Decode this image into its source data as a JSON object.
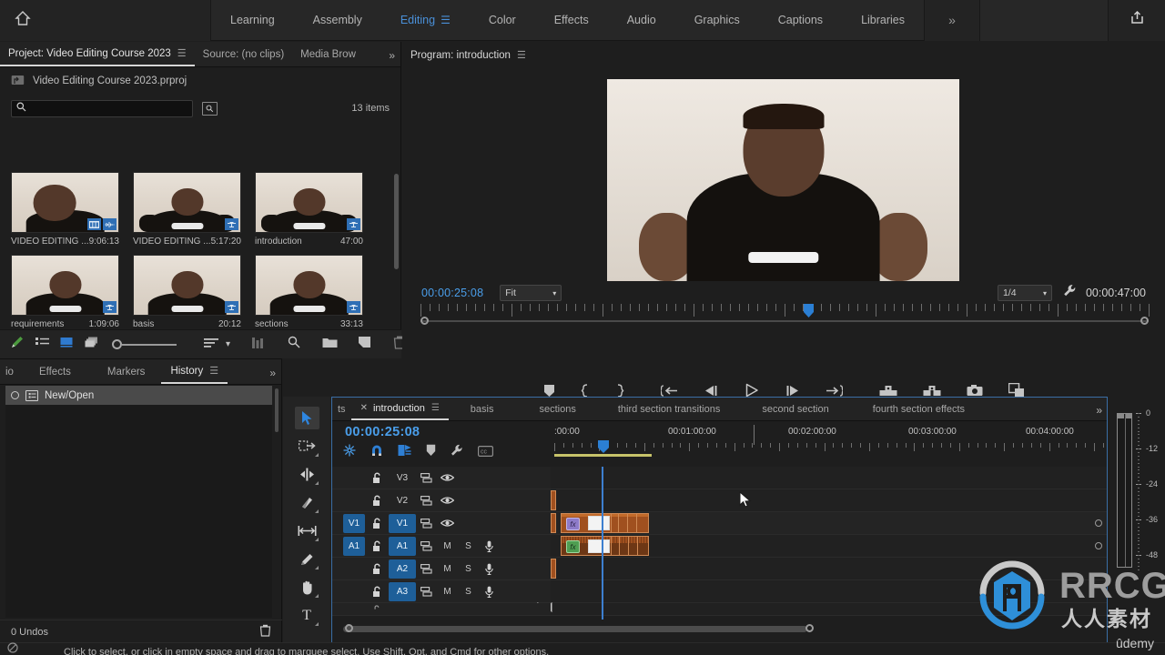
{
  "app": {
    "workspaces": [
      {
        "label": "Learning",
        "active": false
      },
      {
        "label": "Assembly",
        "active": false
      },
      {
        "label": "Editing",
        "active": true
      },
      {
        "label": "Color",
        "active": false
      },
      {
        "label": "Effects",
        "active": false
      },
      {
        "label": "Audio",
        "active": false
      },
      {
        "label": "Graphics",
        "active": false
      },
      {
        "label": "Captions",
        "active": false
      },
      {
        "label": "Libraries",
        "active": false
      }
    ],
    "overflow_label": "»",
    "home_icon": "home-icon",
    "export_icon": "export-icon"
  },
  "project_panel": {
    "tabs": [
      {
        "label": "Project: Video Editing Course 2023",
        "active": true,
        "has_menu": true
      },
      {
        "label": "Source: (no clips)",
        "active": false,
        "has_menu": false
      },
      {
        "label": "Media Brow",
        "active": false,
        "has_menu": false
      }
    ],
    "overflow_label": "»",
    "project_file": "Video Editing Course 2023.prproj",
    "search_placeholder": "",
    "search_value": "",
    "items_count": "13 items",
    "clips": [
      [
        {
          "name": "VIDEO EDITING ...",
          "duration": "9:06:13",
          "badges": [
            "filmstrip-badge",
            "waveform-badge"
          ]
        },
        {
          "name": "VIDEO EDITING ...",
          "duration": "5:17:20",
          "badges": [
            "sequence-badge"
          ]
        },
        {
          "name": "introduction",
          "duration": "47:00",
          "badges": [
            "sequence-badge"
          ]
        }
      ],
      [
        {
          "name": "requirements",
          "duration": "1:09:06",
          "badges": [
            "sequence-badge"
          ]
        },
        {
          "name": "basis",
          "duration": "20:12",
          "badges": [
            "sequence-badge"
          ]
        },
        {
          "name": "sections",
          "duration": "33:13",
          "badges": [
            "sequence-badge"
          ]
        }
      ]
    ],
    "toolbar_icons": [
      "pen-icon",
      "list-view-icon",
      "icon-view-icon",
      "freeform-view-icon",
      "zoom-slider",
      "sort-icon",
      "chevron-down-icon",
      "columns-icon",
      "find-icon",
      "new-bin-icon",
      "new-item-icon",
      "trash-icon"
    ]
  },
  "history_panel": {
    "tabs": [
      {
        "label": "io",
        "active": false
      },
      {
        "label": "Effects",
        "active": false
      },
      {
        "label": "Markers",
        "active": false
      },
      {
        "label": "History",
        "active": true,
        "has_menu": true
      }
    ],
    "overflow_label": "»",
    "items": [
      {
        "label": "New/Open",
        "icon": "document-icon",
        "selected": true
      }
    ],
    "undo_count": "0 Undos",
    "trash_icon": "trash-icon"
  },
  "tools": [
    {
      "name": "selection-tool",
      "glyph": "➤",
      "active": true
    },
    {
      "name": "track-select-forward-tool",
      "glyph": "⇨",
      "active": false
    },
    {
      "name": "ripple-edit-tool",
      "glyph": "↔",
      "active": false
    },
    {
      "name": "razor-tool",
      "glyph": "◧",
      "active": false
    },
    {
      "name": "slip-tool",
      "glyph": "|↔|",
      "active": false
    },
    {
      "name": "pen-tool",
      "glyph": "✒",
      "active": false
    },
    {
      "name": "hand-tool",
      "glyph": "✋",
      "active": false
    },
    {
      "name": "type-tool",
      "glyph": "T",
      "active": false
    }
  ],
  "program_monitor": {
    "tab_label": "Program: introduction",
    "menu_icon": "panel-menu-icon",
    "current_time": "00:00:25:08",
    "fit_select": "Fit",
    "resolution_select": "1/4",
    "settings_icon": "wrench-icon",
    "duration": "00:00:47:00",
    "playhead_pct": 52.6,
    "transport_row1": [
      "add-marker-icon",
      "mark-in-icon",
      "mark-out-icon",
      "go-to-in-icon",
      "step-back-icon",
      "play-icon",
      "step-forward-icon",
      "go-to-out-icon",
      "lift-icon",
      "extract-icon",
      "export-frame-icon",
      "comparison-view-icon"
    ],
    "transport_row2": [
      "safe-margins-icon",
      "settings-ruler-icon",
      "fx-icon",
      "multicam-icon"
    ],
    "plus_button": "+"
  },
  "timeline": {
    "tabs": [
      {
        "label": "ts",
        "active": false
      },
      {
        "label": "introduction",
        "active": true,
        "closable": true,
        "has_menu": true
      },
      {
        "label": "basis",
        "active": false
      },
      {
        "label": "sections",
        "active": false
      },
      {
        "label": "third section transitions",
        "active": false
      },
      {
        "label": "second section",
        "active": false
      },
      {
        "label": "fourth section effects",
        "active": false
      }
    ],
    "overflow_label": "»",
    "current_time": "00:00:25:08",
    "header_icons": [
      "sequence-settings-icon",
      "snap-icon",
      "linked-selection-icon",
      "add-marker-icon",
      "timeline-settings-icon",
      "captions-icon"
    ],
    "ruler_labels": [
      {
        "text": ":00:00",
        "pct": 1.0
      },
      {
        "text": "00:01:00:00",
        "pct": 22.0
      },
      {
        "text": "00:02:00:00",
        "pct": 43.5
      },
      {
        "text": "00:03:00:00",
        "pct": 65.0
      },
      {
        "text": "00:04:00:00",
        "pct": 86.5
      }
    ],
    "tracks": [
      {
        "name": "V3",
        "type": "video",
        "source_btn": "",
        "source_on": false,
        "target_on": false,
        "lock": "unlocked",
        "sync": "sync-icon",
        "eye": "eye-icon"
      },
      {
        "name": "V2",
        "type": "video",
        "source_btn": "",
        "source_on": false,
        "target_on": false,
        "lock": "unlocked",
        "sync": "sync-icon",
        "eye": "eye-icon"
      },
      {
        "name": "V1",
        "type": "video",
        "source_btn": "V1",
        "source_on": true,
        "target_on": true,
        "lock": "unlocked",
        "sync": "sync-icon",
        "eye": "eye-icon"
      },
      {
        "name": "A1",
        "type": "audio",
        "source_btn": "A1",
        "source_on": true,
        "target_on": true,
        "lock": "unlocked",
        "sync": "sync-icon",
        "mute": "M",
        "solo": "S",
        "mic": "mic-icon"
      },
      {
        "name": "A2",
        "type": "audio",
        "source_btn": "",
        "source_on": false,
        "target_on": true,
        "lock": "unlocked",
        "sync": "sync-icon",
        "mute": "M",
        "solo": "S",
        "mic": "mic-icon"
      },
      {
        "name": "A3",
        "type": "audio",
        "source_btn": "",
        "source_on": false,
        "target_on": true,
        "lock": "unlocked",
        "sync": "sync-icon",
        "mute": "M",
        "solo": "S",
        "mic": "mic-icon"
      }
    ],
    "clips": {
      "video_clip_fx_badge": "fx",
      "audio_clip_fx_badge": "fx"
    }
  },
  "audio_meters": {
    "scale_labels": [
      "0",
      "-12",
      "-24",
      "-36",
      "-48"
    ]
  },
  "status_bar": {
    "icon": "tool-hint-icon",
    "text": "Click to select, or click in empty space and drag to marquee select. Use Shift, Opt, and Cmd for other options."
  },
  "watermark": {
    "brand": "RRCG",
    "chinese": "人人素材",
    "platform": "ûdemy"
  },
  "colors": {
    "accent_blue": "#4a9eea",
    "panel_bg": "#1e1e1e",
    "chrome_bg": "#232323",
    "clip_orange": "#a0501f",
    "track_target_blue": "#1e5f99",
    "workbar_yellow": "#c7c36a"
  }
}
